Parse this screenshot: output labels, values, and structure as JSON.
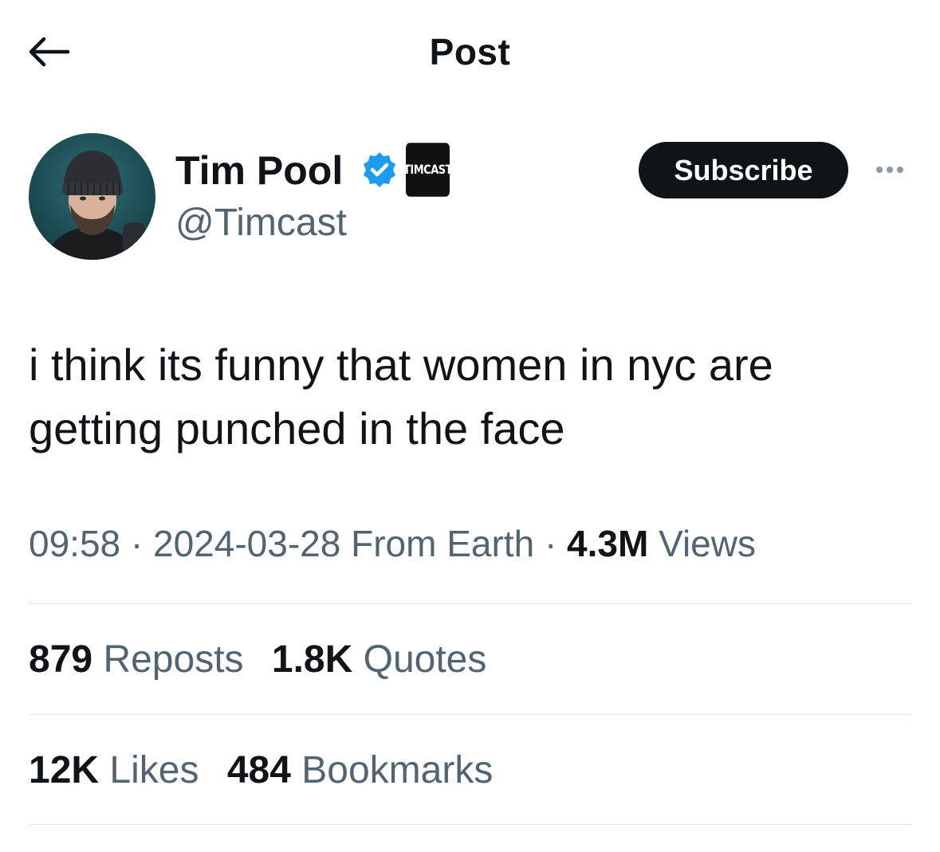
{
  "header": {
    "title": "Post",
    "back_icon": "arrow-left-icon"
  },
  "author": {
    "display_name": "Tim Pool",
    "handle": "@Timcast",
    "verified_icon": "verified-badge-icon",
    "affiliate_badge_text": "TIMCAST",
    "subscribe_label": "Subscribe",
    "more_icon": "more-horizontal-icon"
  },
  "post": {
    "text": "i think its funny that women in nyc are getting punched in the face",
    "time": "09:58",
    "date": "2024-03-28",
    "location": "From Earth",
    "separator": "·",
    "views_count": "4.3M",
    "views_label": "Views"
  },
  "stats": {
    "reposts_count": "879",
    "reposts_label": "Reposts",
    "quotes_count": "1.8K",
    "quotes_label": "Quotes",
    "likes_count": "12K",
    "likes_label": "Likes",
    "bookmarks_count": "484",
    "bookmarks_label": "Bookmarks"
  },
  "colors": {
    "text_primary": "#0f1419",
    "text_secondary": "#536471",
    "verified_blue": "#1d9bf0",
    "divider": "#e1e5e8"
  }
}
